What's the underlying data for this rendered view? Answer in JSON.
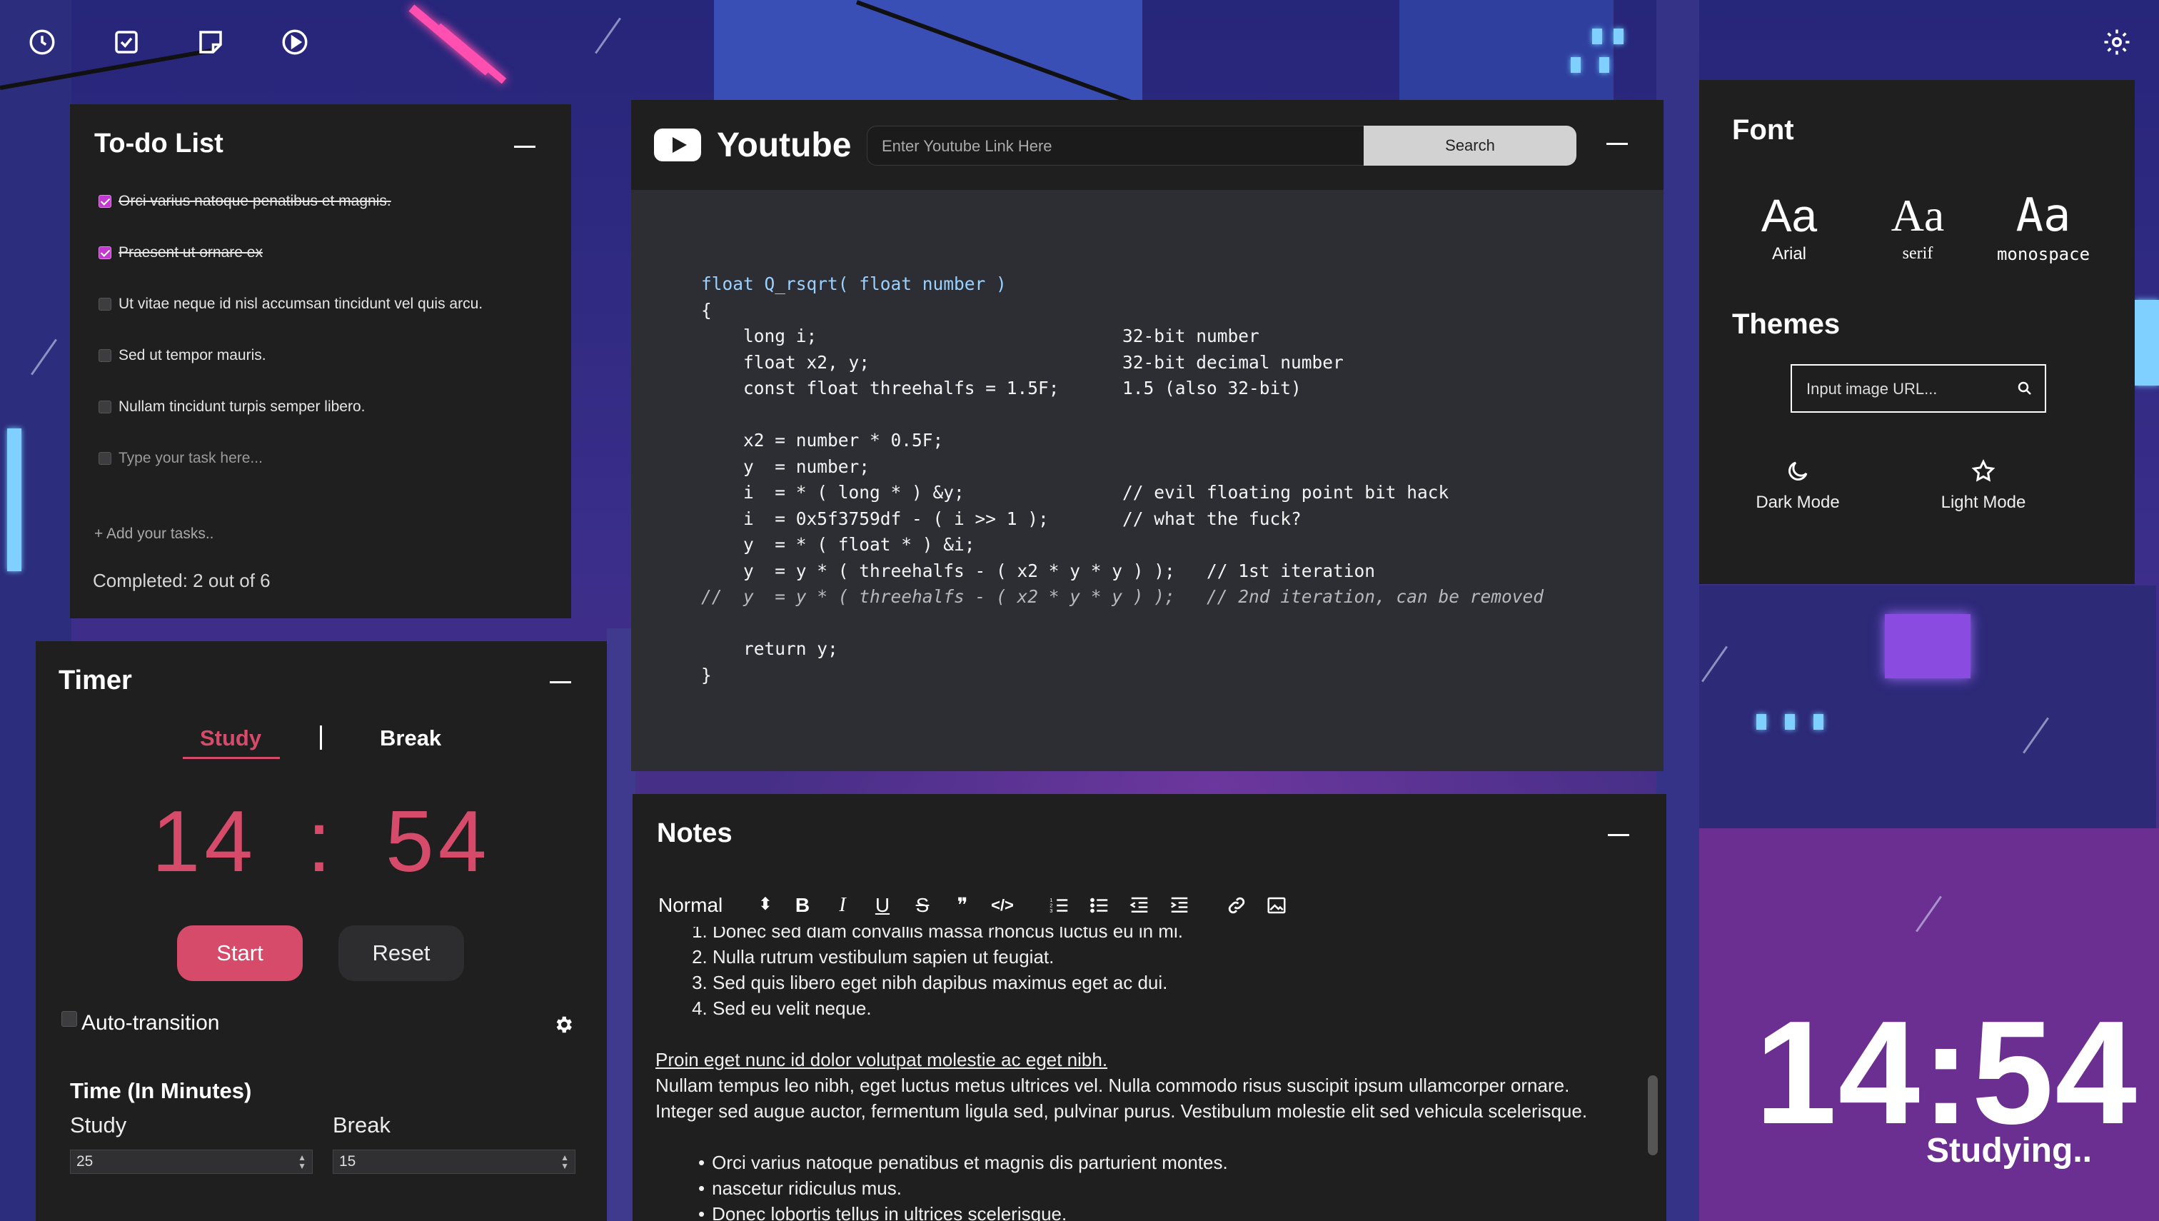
{
  "top_icons": [
    "clock-icon",
    "checklist-icon",
    "notes-icon",
    "play-icon"
  ],
  "settings_icon": "gear-icon",
  "todo": {
    "title": "To-do List",
    "tasks": [
      {
        "text": "Orci varius natoque penatibus et magnis.",
        "done": true
      },
      {
        "text": "Praesent ut ornare ex",
        "done": true
      },
      {
        "text": "Ut vitae neque id nisl accumsan tincidunt vel quis arcu.",
        "done": false
      },
      {
        "text": "Sed ut tempor mauris.",
        "done": false
      },
      {
        "text": "Nullam tincidunt turpis semper libero.",
        "done": false
      }
    ],
    "new_task_placeholder": "Type your task here...",
    "add_label": "+ Add your tasks..",
    "completed_label": "Completed: 2 out of 6",
    "accent": "#c23ad0"
  },
  "timer": {
    "title": "Timer",
    "tab_study": "Study",
    "tab_break": "Break",
    "minutes": "14",
    "colon": ":",
    "seconds": "54",
    "start_label": "Start",
    "reset_label": "Reset",
    "auto_transition_label": "Auto-transition",
    "time_title": "Time (In Minutes)",
    "study_label": "Study",
    "break_label": "Break",
    "study_value": "25",
    "break_value": "15",
    "accent": "#d64b6a"
  },
  "youtube": {
    "title": "Youtube",
    "input_placeholder": "Enter Youtube Link Here",
    "search_label": "Search"
  },
  "code": {
    "lines": [
      "float Q_rsqrt( float number )",
      "{",
      "    long i;                             32-bit number",
      "    float x2, y;                        32-bit decimal number",
      "    const float threehalfs = 1.5F;      1.5 (also 32-bit)",
      "",
      "    x2 = number * 0.5F;",
      "    y  = number;",
      "    i  = * ( long * ) &y;               // evil floating point bit hack",
      "    i  = 0x5f3759df - ( i >> 1 );       // what the fuck?",
      "    y  = * ( float * ) &i;",
      "    y  = y * ( threehalfs - ( x2 * y * y ) );   // 1st iteration",
      "//  y  = y * ( threehalfs - ( x2 * y * y ) );   // 2nd iteration, can be removed",
      "",
      "    return y;",
      "}"
    ]
  },
  "notes": {
    "title": "Notes",
    "format_select": "Normal",
    "ordered": [
      "Donec sed diam convallis massa rhoncus luctus eu in mi.",
      "Nulla rutrum vestibulum sapien ut feugiat.",
      "Sed quis libero eget nibh dapibus maximus eget ac dui.",
      "Sed eu velit neque."
    ],
    "link_line": "Proin eget nunc id dolor volutpat molestie ac eget nibh.",
    "para1": "Nullam tempus leo nibh, eget luctus metus ultrices vel. Nulla commodo risus suscipit ipsum ullamcorper ornare.",
    "para2": "Integer sed augue auctor, fermentum ligula sed, pulvinar purus. Vestibulum molestie elit sed vehicula scelerisque.",
    "bullets": [
      "Orci varius natoque penatibus et magnis dis parturient montes.",
      "nascetur ridiculus mus.",
      "Donec lobortis tellus in ultrices scelerisque."
    ]
  },
  "font_panel": {
    "title": "Font",
    "sample": "Aa",
    "options": [
      "Arial",
      "serif",
      "monospace"
    ],
    "themes_title": "Themes",
    "url_placeholder": "Input image URL...",
    "dark_mode": "Dark Mode",
    "light_mode": "Light Mode"
  },
  "clock": {
    "time": "14:54",
    "status": "Studying.."
  }
}
